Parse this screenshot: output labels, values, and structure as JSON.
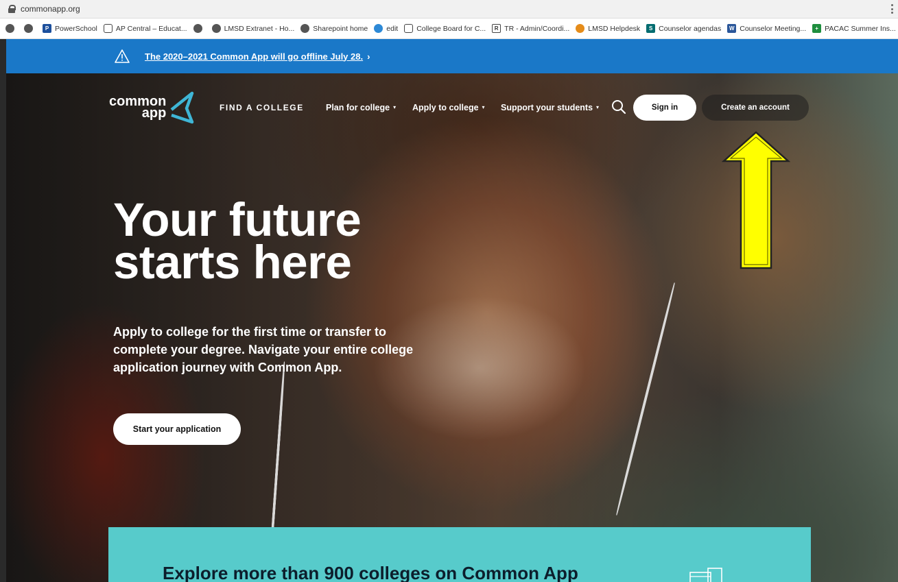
{
  "browser": {
    "url": "commonapp.org",
    "bookmarks": [
      {
        "label": "",
        "icon": "globe-icon"
      },
      {
        "label": "",
        "icon": "globe-icon"
      },
      {
        "label": "PowerSchool",
        "icon": "powerschool-icon"
      },
      {
        "label": "AP Central – Educat...",
        "icon": "collegeboard-icon"
      },
      {
        "label": "",
        "icon": "globe-icon"
      },
      {
        "label": "LMSD Extranet - Ho...",
        "icon": "globe-icon"
      },
      {
        "label": "Sharepoint home",
        "icon": "globe-icon"
      },
      {
        "label": "edit",
        "icon": "edit-icon"
      },
      {
        "label": "College Board for C...",
        "icon": "collegeboard-icon"
      },
      {
        "label": "TR - Admin/Coordi...",
        "icon": "tr-icon"
      },
      {
        "label": "LMSD Helpdesk",
        "icon": "helpdesk-icon"
      },
      {
        "label": "Counselor agendas",
        "icon": "sharepoint-icon"
      },
      {
        "label": "Counselor Meeting...",
        "icon": "word-icon"
      },
      {
        "label": "PACAC Summer Ins...",
        "icon": "plus-icon"
      }
    ]
  },
  "alert": {
    "message": "The 2020–2021 Common App will go offline July 28.",
    "chevron": "›"
  },
  "header": {
    "logo_top": "common",
    "logo_bottom": "app",
    "find_college": "FIND A COLLEGE",
    "nav": [
      {
        "label": "Plan for college"
      },
      {
        "label": "Apply to college"
      },
      {
        "label": "Support your students"
      }
    ],
    "caret": "▾",
    "sign_in": "Sign in",
    "create_account": "Create an account"
  },
  "hero": {
    "headline_line1": "Your future",
    "headline_line2": "starts here",
    "subcopy": "Apply to college for the first time or transfer to complete your degree. Navigate your entire college application journey with Common App.",
    "cta": "Start your application"
  },
  "explore": {
    "title": "Explore more than 900 colleges on Common App"
  },
  "colors": {
    "alert_bg": "#1a78c8",
    "teal_panel": "#57cbcb",
    "arrow_fill": "#ffff00",
    "logo_accent": "#3fb6d6"
  }
}
